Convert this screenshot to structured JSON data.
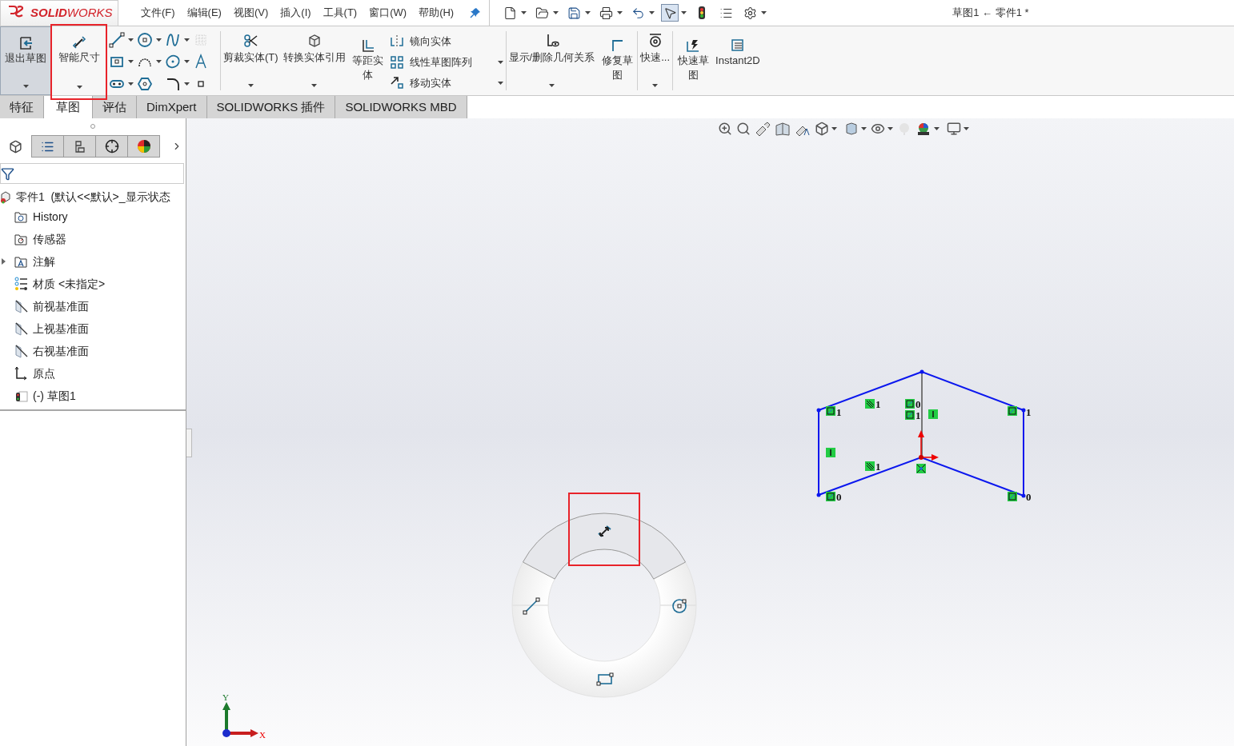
{
  "app": {
    "logo": "**SOLID**WORKS",
    "menu": [
      "文件(F)",
      "编辑(E)",
      "视图(V)",
      "插入(I)",
      "工具(T)",
      "窗口(W)",
      "帮助(H)"
    ],
    "title": "草图1 ← 零件1 *"
  },
  "quick_access": [
    {
      "kind": "new",
      "selected": false
    },
    {
      "kind": "open",
      "selected": false
    },
    {
      "kind": "save",
      "selected": false
    },
    {
      "kind": "print",
      "selected": false
    },
    {
      "kind": "undo",
      "selected": false
    },
    {
      "kind": "select",
      "selected": true
    },
    {
      "kind": "rebuild",
      "selected": false
    },
    {
      "kind": "properties",
      "selected": false
    },
    {
      "kind": "options",
      "selected": false
    }
  ],
  "ribbon": {
    "exit": {
      "label": "退出草图",
      "selected": true
    },
    "smart_dimension": {
      "label": "智能尺寸",
      "selected": false,
      "highlighted": true
    },
    "large_tools": [
      {
        "kind": "trim",
        "label": "剪裁实体(T)"
      },
      {
        "kind": "convert",
        "label": "转换实体引用"
      },
      {
        "kind": "offset",
        "label": "等距实体"
      }
    ],
    "list_tools": [
      {
        "kind": "mirror",
        "label": "镜向实体"
      },
      {
        "kind": "pattern",
        "label": "线性草图阵列"
      },
      {
        "kind": "move",
        "label": "移动实体"
      }
    ],
    "relation_tools": [
      {
        "kind": "relations",
        "label": "显示/删除几何关系"
      },
      {
        "kind": "repair",
        "label": "修复草图"
      },
      {
        "kind": "quick",
        "label": "快速..."
      }
    ],
    "extra_tools": [
      {
        "kind": "quick-sketch",
        "label": "快速草图"
      },
      {
        "kind": "instant2d",
        "label": "Instant2D"
      }
    ]
  },
  "tabs": [
    {
      "label": "特征",
      "selected": false
    },
    {
      "label": "草图",
      "selected": true
    },
    {
      "label": "评估",
      "selected": false
    },
    {
      "label": "DimXpert",
      "selected": false
    },
    {
      "label": "SOLIDWORKS 插件",
      "selected": false
    },
    {
      "label": "SOLIDWORKS MBD",
      "selected": false
    }
  ],
  "panel": {
    "tabs": [
      {
        "kind": "feature",
        "selected": true
      },
      {
        "kind": "property",
        "selected": false
      },
      {
        "kind": "configuration",
        "selected": false
      },
      {
        "kind": "dimxpert",
        "selected": false
      },
      {
        "kind": "display",
        "selected": false
      }
    ],
    "tree": {
      "label": "零件1  (默认<<默认>_显示状态",
      "children": [
        {
          "kind": "history",
          "label": "History",
          "expandable": false
        },
        {
          "kind": "sensor",
          "label": "传感器",
          "expandable": false
        },
        {
          "kind": "annotation",
          "label": "注解",
          "expandable": true
        },
        {
          "kind": "material",
          "label": "材质 <未指定>",
          "expandable": false
        },
        {
          "kind": "plane",
          "label": "前视基准面",
          "expandable": false
        },
        {
          "kind": "plane",
          "label": "上视基准面",
          "expandable": false
        },
        {
          "kind": "plane",
          "label": "右视基准面",
          "expandable": false
        },
        {
          "kind": "origin",
          "label": "原点",
          "expandable": false
        },
        {
          "kind": "sketch",
          "label": "(-) 草图1",
          "expandable": false
        }
      ]
    }
  },
  "canvas": {
    "relation_labels": [
      "1",
      "1",
      "0",
      "1",
      "1",
      "1",
      "0",
      "0"
    ],
    "radial_menu": [
      {
        "kind": "dimension",
        "highlighted": true
      },
      {
        "kind": "line",
        "highlighted": false
      },
      {
        "kind": "circle",
        "highlighted": false
      },
      {
        "kind": "rectangle",
        "highlighted": false
      }
    ],
    "triad": {
      "y": "Y",
      "x": "X"
    }
  }
}
